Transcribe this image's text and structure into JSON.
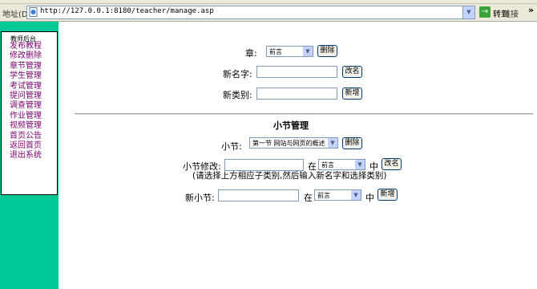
{
  "browser": {
    "address_label": "地址(D)",
    "url": "http://127.0.0.1:8180/teacher/manage.asp",
    "go_label": "转到",
    "links_label": "链接",
    "more_glyph": "»"
  },
  "sidebar": {
    "title": "教师后台",
    "items": [
      {
        "label": "发布教程"
      },
      {
        "label": "修改删除"
      },
      {
        "label": "章节管理"
      },
      {
        "label": "学生管理"
      },
      {
        "label": "考试管理"
      },
      {
        "label": "提问管理"
      },
      {
        "label": "调查管理"
      },
      {
        "label": "作业管理"
      },
      {
        "label": "视频管理"
      },
      {
        "label": "首页公告"
      },
      {
        "label": "返回首页"
      },
      {
        "label": "退出系统"
      }
    ]
  },
  "chapter": {
    "chapter_label": "章:",
    "chapter_select": "前言",
    "delete_button": "删除",
    "new_name_label": "新名字:",
    "new_name_value": "",
    "rename_button": "改名",
    "new_category_label": "新类别:",
    "new_category_value": "",
    "add_button": "新增"
  },
  "section": {
    "title": "小节管理",
    "section_label": "小节:",
    "section_select": "第一节 网站与网页的概述",
    "delete_button": "删除",
    "modify_label": "小节修改:",
    "modify_value": "",
    "in_label": "在",
    "modify_chapter_select": "前言",
    "mid_label": "中",
    "rename_button": "改名",
    "hint": "(请选择上方相应子类别,然后输入新名字和选择类别)",
    "new_section_label": "新小节:",
    "new_section_value": "",
    "new_in_label": "在",
    "new_chapter_select": "前言",
    "new_mid_label": "中",
    "add_button": "新增"
  },
  "icons": {
    "dropdown": "▼",
    "go": "→"
  }
}
